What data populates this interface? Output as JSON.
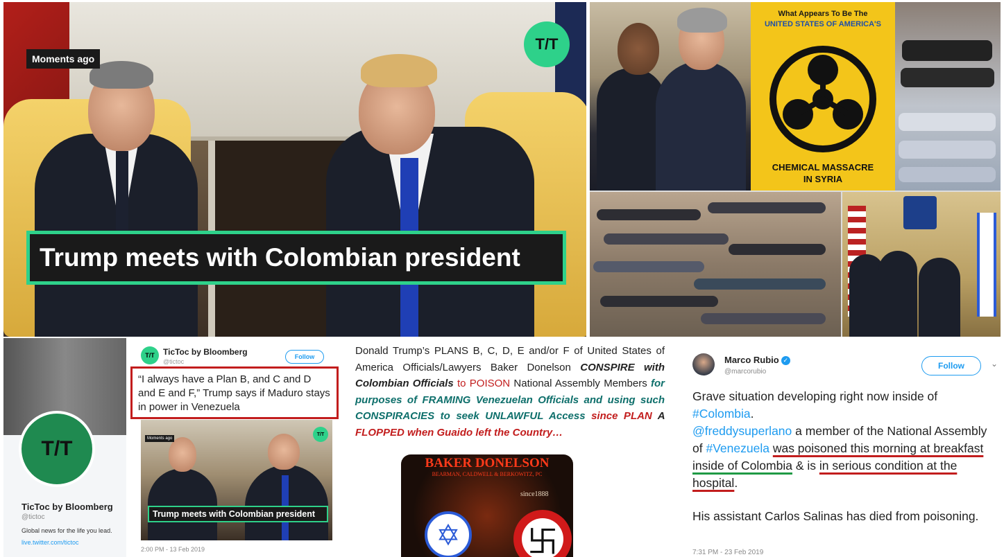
{
  "video": {
    "badge": "Moments ago",
    "logo": "T/T",
    "headline": "Trump meets with Colombian president"
  },
  "collage": {
    "hazard_top_line1": "What Appears To Be The",
    "hazard_top_line2": "UNITED STATES OF AMERICA'S",
    "hazard_bottom_line1": "CHEMICAL MASSACRE",
    "hazard_bottom_line2": "IN SYRIA",
    "hazard_icon": "biohazard-icon"
  },
  "profile": {
    "name": "TicToc by Bloomberg",
    "handle": "@tictoc",
    "bio": "Global news for the life you lead.",
    "link": "live.twitter.com/tictoc",
    "avatar_text": "T/T"
  },
  "tictoc_tweet": {
    "name": "TicToc by Bloomberg",
    "handle": "@tictoc",
    "follow": "Follow",
    "quote": "“I always have a Plan B, and C and D and E and F,” Trump says if Maduro stays in power in Venezuela",
    "mini_badge": "Moments ago",
    "mini_headline": "Trump meets with Colombian president",
    "mini_logo": "T/T",
    "date": "2:00 PM - 13 Feb 2019"
  },
  "middle": {
    "p1": "Donald Trump’s PLANS B, C, D, E and/or F of United States of America Officials/Lawyers Baker Donelson ",
    "p2": "CONSPIRE with Colombian Officials",
    "p3": " to POISON",
    "p4": " National Assembly Members ",
    "p5": "for purposes of FRAMING Venezuelan Officials and using such CONSPIRACIES to seek UNLAWFUL Access",
    "p6": " since PLAN ",
    "p7": "A",
    "p8": " FLOPPED when Guaido left the Country…",
    "logo_title": "BAKER DONELSON",
    "logo_sub": "BEARMAN, CALDWELL & BERKOWITZ, PC",
    "logo_since": "since1888"
  },
  "rubio_tweet": {
    "name": "Marco Rubio",
    "handle": "@marcorubio",
    "follow": "Follow",
    "t1": "Grave situation developing right now inside of ",
    "t2": "#Colombia",
    "t3": ".",
    "t4": "@freddysuperlano",
    "t5": " a member of the National Assembly of ",
    "t6": "#Venezuela",
    "t7": " ",
    "t8": "was poisoned this morning at breakfast",
    "t9": " ",
    "t10": "inside of  Colombia",
    "t11": " & is ",
    "t12": "in serious condition at the hospital",
    "t13": ".",
    "t14": "His assistant Carlos Salinas has died from poisoning.",
    "date": "7:31 PM - 23 Feb 2019"
  }
}
